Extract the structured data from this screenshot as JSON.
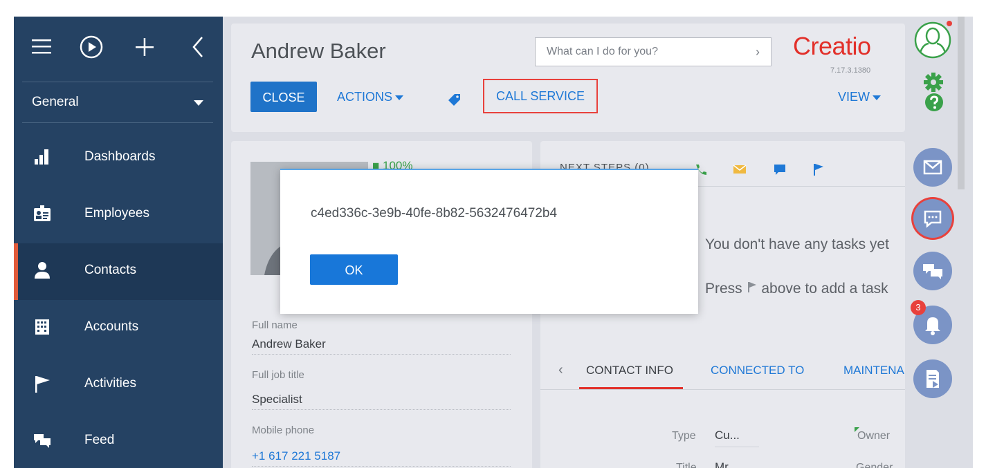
{
  "colors": {
    "sidebar_bg": "#254263",
    "accent_blue": "#1e78d6",
    "brand_red": "#e2302a",
    "highlight_red": "#e8413c",
    "progress_green": "#3aa14a"
  },
  "sidebar": {
    "top_icons": [
      "menu-icon",
      "play-icon",
      "plus-icon",
      "collapse-icon"
    ],
    "workplace": "General",
    "items": [
      {
        "label": "Dashboards",
        "icon": "bar-chart-icon"
      },
      {
        "label": "Employees",
        "icon": "id-badge-icon"
      },
      {
        "label": "Contacts",
        "icon": "person-icon",
        "active": true
      },
      {
        "label": "Accounts",
        "icon": "building-icon"
      },
      {
        "label": "Activities",
        "icon": "flag-icon"
      },
      {
        "label": "Feed",
        "icon": "chat-icon"
      }
    ]
  },
  "header": {
    "title": "Andrew Baker",
    "close_label": "CLOSE",
    "actions_label": "ACTIONS",
    "call_service_label": "CALL SERVICE",
    "view_label": "VIEW",
    "search_placeholder": "What can I do for you?",
    "search_arrow": "›",
    "logo": "Creatio",
    "version": "7.17.3.1380"
  },
  "profile": {
    "completeness": "100%",
    "fields": [
      {
        "label": "Full name",
        "value": "Andrew Baker"
      },
      {
        "label": "Full job title",
        "value": "Specialist"
      },
      {
        "label": "Mobile phone",
        "value": "+1 617 221 5187"
      }
    ]
  },
  "next_steps": {
    "title": "NEXT STEPS (0)",
    "empty_message": "You don't have any tasks yet",
    "hint_prefix": "Press",
    "hint_suffix": "above to add a task"
  },
  "tabs": {
    "prev": "‹",
    "items": [
      "CONTACT INFO",
      "CONNECTED TO",
      "MAINTENANCE"
    ]
  },
  "contact_info": {
    "type_label": "Type",
    "type_value": "Cu...",
    "owner_label": "Owner",
    "title_label": "Title",
    "title_value": "Mr.",
    "gender_label": "Gender"
  },
  "rail": {
    "notification_count": "3"
  },
  "dialog": {
    "message": "c4ed336c-3e9b-40fe-8b82-5632476472b4",
    "ok_label": "OK"
  }
}
